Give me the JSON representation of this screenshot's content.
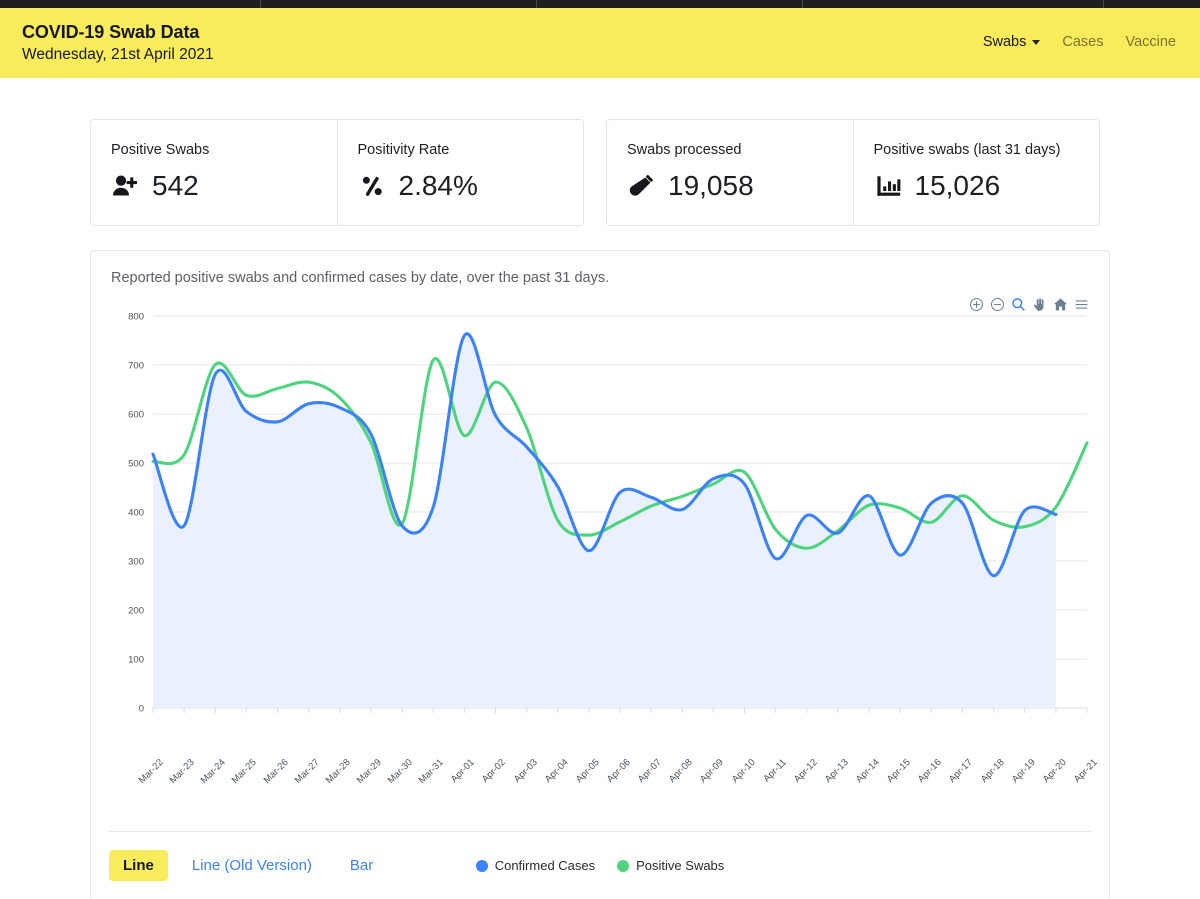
{
  "header": {
    "title": "COVID-19 Swab Data",
    "date": "Wednesday, 21st April 2021",
    "accent_color": "#f9ec5c",
    "nav": [
      {
        "label": "Swabs",
        "active": true,
        "has_caret": true
      },
      {
        "label": "Cases",
        "active": false,
        "has_caret": false
      },
      {
        "label": "Vaccine",
        "active": false,
        "has_caret": false
      }
    ]
  },
  "stats": [
    {
      "label": "Positive Swabs",
      "value": "542",
      "icon": "person-plus-icon"
    },
    {
      "label": "Positivity Rate",
      "value": "2.84%",
      "icon": "percent-icon"
    },
    {
      "label": "Swabs processed",
      "value": "19,058",
      "icon": "test-tube-icon"
    },
    {
      "label": "Positive swabs (last 31 days)",
      "value": "15,026",
      "icon": "bar-chart-icon"
    }
  ],
  "chart_card": {
    "caption": "Reported positive swabs and confirmed cases by date, over the past 31 days.",
    "toolbar": [
      {
        "name": "zoom-in-icon",
        "active": false
      },
      {
        "name": "zoom-out-icon",
        "active": false
      },
      {
        "name": "selection-zoom-icon",
        "active": true
      },
      {
        "name": "pan-icon",
        "active": false
      },
      {
        "name": "home-reset-icon",
        "active": false
      },
      {
        "name": "menu-icon",
        "active": false
      }
    ],
    "chart_types": [
      {
        "label": "Line",
        "active": true
      },
      {
        "label": "Line (Old Version)",
        "active": false
      },
      {
        "label": "Bar",
        "active": false
      }
    ]
  },
  "chart_data": {
    "type": "line",
    "title": "",
    "subtitle": "Reported positive swabs and confirmed cases by date, over the past 31 days.",
    "xlabel": "",
    "ylabel": "",
    "ylim": [
      0,
      800
    ],
    "yticks": [
      0,
      100,
      200,
      300,
      400,
      500,
      600,
      700,
      800
    ],
    "grid": true,
    "legend_position": "bottom-center",
    "area_fill": true,
    "categories": [
      "Mar-22",
      "Mar-23",
      "Mar-24",
      "Mar-25",
      "Mar-26",
      "Mar-27",
      "Mar-28",
      "Mar-29",
      "Mar-30",
      "Mar-31",
      "Apr-01",
      "Apr-02",
      "Apr-03",
      "Apr-04",
      "Apr-05",
      "Apr-06",
      "Apr-07",
      "Apr-08",
      "Apr-09",
      "Apr-10",
      "Apr-11",
      "Apr-12",
      "Apr-13",
      "Apr-14",
      "Apr-15",
      "Apr-16",
      "Apr-17",
      "Apr-18",
      "Apr-19",
      "Apr-20",
      "Apr-21"
    ],
    "series": [
      {
        "name": "Confirmed Cases",
        "color": "#3b82f6",
        "values": [
          518,
          372,
          681,
          605,
          584,
          621,
          613,
          559,
          372,
          410,
          760,
          597,
          533,
          452,
          321,
          440,
          430,
          405,
          468,
          457,
          305,
          393,
          357,
          433,
          312,
          418,
          418,
          270,
          403,
          395,
          null
        ]
      },
      {
        "name": "Positive Swabs",
        "color": "#4ed47f",
        "values": [
          503,
          517,
          701,
          638,
          652,
          665,
          633,
          542,
          376,
          710,
          556,
          665,
          572,
          383,
          353,
          380,
          412,
          432,
          457,
          481,
          364,
          326,
          362,
          414,
          408,
          379,
          433,
          383,
          370,
          410,
          541
        ]
      }
    ]
  }
}
